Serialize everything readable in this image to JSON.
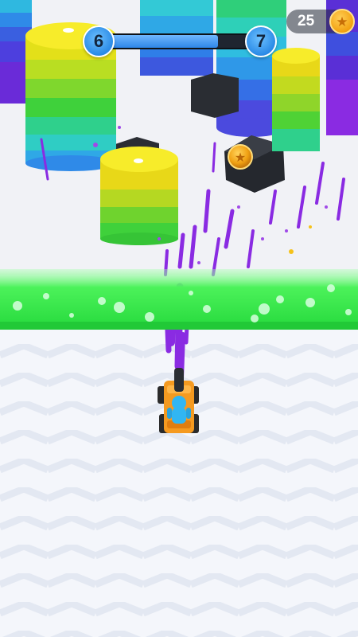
{
  "hud": {
    "current_level": "6",
    "next_level": "7",
    "level_progress": 0.74,
    "coins": "25",
    "coin_icon": "star-coin-icon"
  },
  "scene": {
    "colors": {
      "yellow": "#f7e21c",
      "green": "#3fd13b",
      "cyan": "#2fd2c8",
      "blue": "#2d6fe8",
      "purple": "#8a2be2",
      "gate": "#3cf04a",
      "kart": "#f59a20",
      "driver": "#31b6f2"
    },
    "pickup_coin_icon": "star-coin-icon"
  }
}
